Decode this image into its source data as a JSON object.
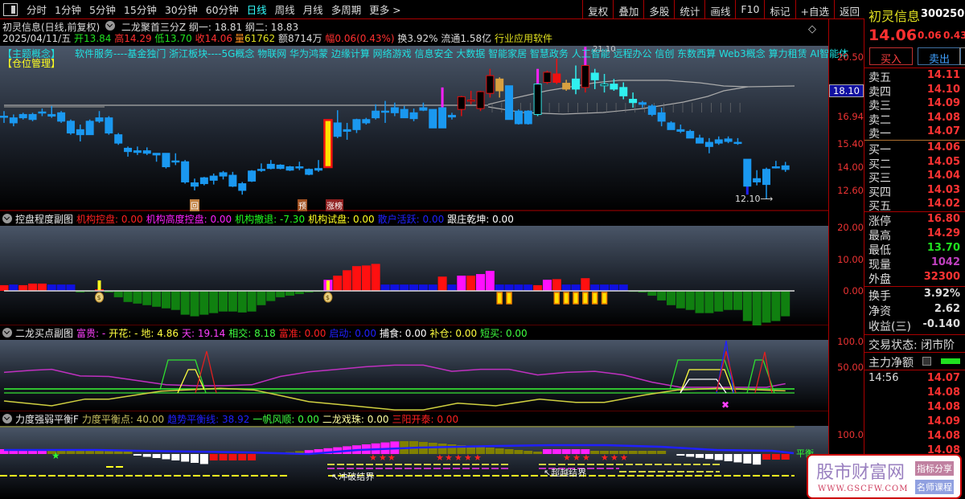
{
  "toolbar": {
    "periods": [
      "分时",
      "1分钟",
      "5分钟",
      "15分钟",
      "30分钟",
      "60分钟",
      "日线",
      "周线",
      "月线",
      "多周期",
      "更多 >"
    ],
    "active": "日线",
    "right": [
      "复权",
      "叠加",
      "多股",
      "统计",
      "画线",
      "F10",
      "标记",
      "+自选",
      "返回"
    ]
  },
  "header": {
    "title": "初灵信息(日线,前复权)",
    "indicator": "二龙聚首三分Z",
    "gang1": "纲一: 18.81",
    "gang2": "纲二: 18.83",
    "date": "2025/04/11/五",
    "open": "开13.84",
    "high": "高14.29",
    "low": "低13.70",
    "close": "收14.06",
    "vol_label": "量",
    "vol": "61762",
    "amount": "额8714万",
    "range": "幅0.06(0.43%)",
    "turnover": "换3.92%",
    "float": "流通1.58亿",
    "industry": "行业应用软件"
  },
  "theme": {
    "label": "【主题概念】",
    "text": "软件服务----基金独门 浙江板块----5G概念 物联网 华为鸿蒙 边缘计算 网络游戏 信息安全 大数据 智能家居 智慧政务 人工智能 远程办公 信创 东数西算 Web3概念 算力租赁 AI智能体",
    "position": "【仓位管理】"
  },
  "main_chart": {
    "y_axis": [
      "20.50",
      "16.94",
      "15.40",
      "14.00",
      "12.60"
    ],
    "highlight": "18.10",
    "markers": {
      "hui": "回",
      "yu": "预",
      "zhangbang": "涨榜"
    },
    "high_label": "21.10",
    "low_label": "12.10",
    "candles": [
      [
        17.0,
        17.3,
        16.6,
        16.95,
        "b"
      ],
      [
        16.9,
        17.1,
        16.4,
        16.6,
        "b"
      ],
      [
        16.9,
        17.2,
        16.8,
        17.1,
        "b"
      ],
      [
        17.1,
        17.2,
        16.7,
        16.8,
        "b"
      ],
      [
        17.2,
        17.45,
        17.0,
        17.25,
        "b"
      ],
      [
        17.1,
        17.6,
        16.9,
        17.0,
        "b"
      ],
      [
        17.2,
        17.3,
        16.6,
        16.7,
        "b"
      ],
      [
        16.7,
        16.8,
        15.9,
        16.0,
        "b"
      ],
      [
        16.2,
        16.5,
        15.5,
        15.9,
        "b"
      ],
      [
        15.9,
        16.8,
        15.9,
        16.7,
        "b"
      ],
      [
        16.9,
        17.3,
        16.6,
        16.7,
        "b"
      ],
      [
        16.9,
        17.0,
        15.9,
        16.0,
        "b"
      ],
      [
        15.9,
        16.0,
        15.3,
        15.4,
        "b"
      ],
      [
        15.1,
        15.2,
        14.6,
        14.9,
        "b"
      ],
      [
        14.95,
        15.2,
        14.7,
        14.85,
        "b"
      ],
      [
        14.95,
        15.15,
        14.7,
        14.8,
        "b"
      ],
      [
        14.8,
        14.8,
        14.3,
        14.7,
        "b"
      ],
      [
        14.8,
        14.8,
        13.9,
        14.0,
        "b"
      ],
      [
        14.35,
        14.8,
        14.1,
        14.3,
        "b"
      ],
      [
        14.3,
        14.4,
        13.0,
        13.1,
        "b"
      ],
      [
        13.05,
        13.3,
        12.6,
        12.85,
        "b"
      ],
      [
        13.0,
        13.4,
        12.9,
        13.35,
        "b"
      ],
      [
        13.2,
        13.6,
        12.95,
        13.45,
        "b"
      ],
      [
        13.45,
        13.75,
        13.25,
        13.65,
        "b"
      ],
      [
        13.5,
        13.7,
        12.8,
        12.85,
        "b"
      ],
      [
        13.0,
        13.1,
        12.35,
        12.6,
        "b"
      ],
      [
        13.15,
        13.8,
        13.1,
        13.75,
        "b"
      ],
      [
        13.8,
        14.2,
        13.7,
        13.85,
        "b"
      ],
      [
        13.9,
        14.4,
        13.85,
        14.15,
        "b"
      ],
      [
        14.1,
        14.15,
        13.85,
        13.9,
        "b"
      ],
      [
        14.0,
        14.05,
        13.75,
        13.8,
        "b"
      ],
      [
        13.95,
        14.3,
        13.8,
        14.0,
        "b"
      ],
      [
        13.85,
        13.9,
        13.5,
        13.55,
        "b"
      ],
      [
        13.8,
        14.4,
        13.7,
        13.9,
        "b"
      ],
      [
        13.98,
        16.77,
        13.95,
        16.77,
        "L"
      ],
      [
        16.6,
        17.35,
        15.7,
        15.8,
        "b"
      ],
      [
        16.1,
        16.6,
        15.6,
        16.2,
        "b"
      ],
      [
        16.2,
        16.85,
        16.0,
        16.8,
        "b"
      ],
      [
        16.6,
        16.9,
        16.5,
        16.8,
        "b"
      ],
      [
        16.9,
        17.7,
        16.8,
        17.3,
        "b"
      ],
      [
        17.3,
        17.9,
        16.6,
        17.3,
        "b"
      ],
      [
        17.2,
        17.8,
        17.0,
        17.5,
        "b"
      ],
      [
        17.4,
        17.6,
        16.9,
        16.9,
        "b"
      ],
      [
        17.2,
        17.45,
        16.7,
        16.85,
        "b"
      ],
      [
        17.5,
        17.8,
        17.3,
        17.35,
        "b"
      ],
      [
        17.4,
        17.4,
        16.3,
        16.3,
        "b"
      ],
      [
        17.5,
        18.7,
        16.3,
        16.3,
        "b",
        "m"
      ],
      [
        17.05,
        17.2,
        16.8,
        16.95,
        "b"
      ],
      [
        17.4,
        18.2,
        17.0,
        18.15,
        "r"
      ],
      [
        17.9,
        18.5,
        17.7,
        17.95,
        "r"
      ],
      [
        17.45,
        18.5,
        17.3,
        18.45,
        "r"
      ],
      [
        18.35,
        19.8,
        18.1,
        19.4,
        "r"
      ],
      [
        19.2,
        19.3,
        18.1,
        18.5,
        "o"
      ],
      [
        18.8,
        18.8,
        16.8,
        16.8,
        "b"
      ],
      [
        17.3,
        17.4,
        16.5,
        16.55,
        "b"
      ],
      [
        17.3,
        17.35,
        16.5,
        16.55,
        "b"
      ],
      [
        17.1,
        19.8,
        17.0,
        18.9,
        "k",
        "m"
      ],
      [
        19.0,
        19.7,
        18.9,
        19.6,
        "r"
      ],
      [
        19.5,
        20.4,
        18.9,
        19.0,
        "R"
      ],
      [
        18.95,
        19.15,
        18.5,
        18.6,
        "o"
      ],
      [
        18.6,
        20.0,
        18.3,
        19.2,
        "c"
      ],
      [
        18.7,
        21.1,
        18.4,
        20.0,
        "r",
        "m"
      ],
      [
        19.55,
        19.8,
        18.6,
        19.15,
        "c"
      ],
      [
        18.9,
        19.5,
        18.4,
        18.8,
        "k"
      ],
      [
        18.9,
        19.2,
        18.5,
        18.6,
        "c"
      ],
      [
        18.7,
        19.0,
        18.0,
        18.2,
        "c"
      ],
      [
        18.0,
        18.4,
        17.5,
        17.8,
        "c"
      ],
      [
        17.8,
        17.9,
        17.5,
        17.7,
        "b"
      ],
      [
        17.6,
        17.7,
        17.0,
        17.1,
        "b"
      ],
      [
        17.2,
        17.5,
        16.4,
        16.7,
        "b"
      ],
      [
        16.6,
        16.7,
        16.2,
        16.2,
        "b"
      ],
      [
        16.2,
        16.5,
        16.0,
        16.1,
        "b"
      ],
      [
        16.1,
        16.2,
        15.7,
        15.7,
        "b"
      ],
      [
        15.7,
        15.9,
        15.4,
        15.4,
        "b"
      ],
      [
        15.45,
        15.7,
        14.8,
        15.2,
        "b"
      ],
      [
        15.4,
        15.8,
        15.3,
        15.6,
        "b"
      ],
      [
        15.5,
        15.8,
        15.4,
        15.65,
        "b"
      ],
      [
        15.45,
        15.7,
        15.3,
        15.4,
        "b"
      ],
      [
        14.45,
        14.45,
        12.35,
        12.85,
        "b"
      ],
      [
        13.3,
        13.8,
        12.9,
        13.1,
        "b"
      ],
      [
        12.95,
        13.95,
        12.1,
        13.85,
        "b"
      ],
      [
        14.0,
        14.35,
        13.9,
        14.0,
        "b"
      ],
      [
        13.84,
        14.29,
        13.7,
        14.06,
        "b"
      ]
    ]
  },
  "panel_control": {
    "title": "控盘程度副图",
    "fields": [
      {
        "label": "机构控盘: 0.00",
        "color": "#ff2020"
      },
      {
        "label": "机构高度控盘: 0.00",
        "color": "#ff20ff"
      },
      {
        "label": "机构撤退: -7.30",
        "color": "#20ff20"
      },
      {
        "label": "机构试盘: 0.00",
        "color": "#ffff20"
      },
      {
        "label": "散户活跃: 0.00",
        "color": "#2020ff"
      },
      {
        "label": "跟庄乾坤: 0.00",
        "color": "#ffffff"
      }
    ],
    "y_axis": [
      "20.00",
      "10.00",
      "0.00"
    ],
    "bars": [
      [
        1.8,
        "r"
      ],
      [
        2,
        "b"
      ],
      [
        1.8,
        "r"
      ],
      [
        2.3,
        "r"
      ],
      [
        2.3,
        "r"
      ],
      [
        2,
        "b"
      ],
      [
        2,
        "b"
      ],
      [
        2,
        "b"
      ],
      [
        -0.5,
        "g"
      ],
      [
        -0.3,
        "g"
      ],
      [
        0.5,
        "r"
      ],
      [
        -0.5,
        "g"
      ],
      [
        -2,
        "g"
      ],
      [
        -3.5,
        "g"
      ],
      [
        -4,
        "g"
      ],
      [
        -4.5,
        "g"
      ],
      [
        -5,
        "g"
      ],
      [
        -5.5,
        "g"
      ],
      [
        -6,
        "g"
      ],
      [
        -7.5,
        "g"
      ],
      [
        -8,
        "g"
      ],
      [
        -7.5,
        "g"
      ],
      [
        -7,
        "g"
      ],
      [
        -6.5,
        "g"
      ],
      [
        -6.5,
        "g"
      ],
      [
        -6.8,
        "g"
      ],
      [
        -6.5,
        "g"
      ],
      [
        -4.5,
        "g"
      ],
      [
        -3.2,
        "g"
      ],
      [
        -2,
        "g"
      ],
      [
        -1.5,
        "g"
      ],
      [
        -1,
        "g"
      ],
      [
        -0.5,
        "g"
      ],
      [
        -0.3,
        "g"
      ],
      [
        3.5,
        "m"
      ],
      [
        4.8,
        "r"
      ],
      [
        6.5,
        "r"
      ],
      [
        7.8,
        "r"
      ],
      [
        8,
        "r"
      ],
      [
        8.5,
        "r"
      ],
      [
        2,
        "b"
      ],
      [
        2,
        "b"
      ],
      [
        2,
        "b"
      ],
      [
        2,
        "b"
      ],
      [
        2,
        "b"
      ],
      [
        2,
        "b"
      ],
      [
        4.5,
        "r"
      ],
      [
        2,
        "b"
      ],
      [
        4.8,
        "m"
      ],
      [
        4.8,
        "r"
      ],
      [
        5.3,
        "m"
      ],
      [
        6.3,
        "m"
      ],
      [
        2,
        "b"
      ],
      [
        2,
        "b"
      ],
      [
        2,
        "b"
      ],
      [
        2,
        "b"
      ],
      [
        1.8,
        "r"
      ],
      [
        3.5,
        "m"
      ],
      [
        3.7,
        "r"
      ],
      [
        2,
        "b"
      ],
      [
        2,
        "b"
      ],
      [
        4,
        "r"
      ],
      [
        2,
        "b"
      ],
      [
        2,
        "b"
      ],
      [
        2,
        "b"
      ],
      [
        2,
        "b"
      ],
      [
        -0.3,
        "g"
      ],
      [
        -0.5,
        "g"
      ],
      [
        -1.5,
        "g"
      ],
      [
        -3,
        "g"
      ],
      [
        -4.5,
        "g"
      ],
      [
        -5.5,
        "g"
      ],
      [
        -6,
        "g"
      ],
      [
        -7,
        "g"
      ],
      [
        -7,
        "g"
      ],
      [
        -6.5,
        "g"
      ],
      [
        -6,
        "g"
      ],
      [
        -6,
        "g"
      ],
      [
        -9.5,
        "g"
      ],
      [
        -11,
        "g"
      ],
      [
        -10,
        "g"
      ],
      [
        -9.5,
        "g"
      ],
      [
        -8,
        "g"
      ]
    ],
    "orange_marks": [
      52,
      53,
      58,
      59,
      60,
      61,
      62,
      63
    ],
    "bag_marks": [
      10,
      34
    ]
  },
  "panel_dragon": {
    "title": "二龙买点副图",
    "fields": [
      {
        "label": "富贵: -",
        "color": "#ff40ff"
      },
      {
        "label": "开花: -",
        "color": "#ffff40"
      },
      {
        "label": "地: 4.86",
        "color": "#ffff40"
      },
      {
        "label": "天: 19.14",
        "color": "#ff40ff"
      },
      {
        "label": "相交: 8.18",
        "color": "#40ff40"
      },
      {
        "label": "富准: 0.00",
        "color": "#ff2020"
      },
      {
        "label": "启动: 0.00",
        "color": "#2020ff"
      },
      {
        "label": "捕食: 0.00",
        "color": "#ffffff"
      },
      {
        "label": "补仓: 0.00",
        "color": "#ffff40"
      },
      {
        "label": "短买: 0.00",
        "color": "#40ff40"
      }
    ],
    "y_axis": [
      "100.0",
      "50.00"
    ],
    "magenta_line": [
      [
        0,
        40
      ],
      [
        3,
        44
      ],
      [
        5,
        46
      ],
      [
        8,
        33
      ],
      [
        11,
        32
      ],
      [
        14,
        24
      ],
      [
        17,
        16
      ],
      [
        20,
        14
      ],
      [
        23,
        14
      ],
      [
        26,
        16
      ],
      [
        29,
        32
      ],
      [
        32,
        41
      ],
      [
        35,
        46
      ],
      [
        38,
        51
      ],
      [
        41,
        54
      ],
      [
        44,
        54
      ],
      [
        47,
        42
      ],
      [
        50,
        46
      ],
      [
        53,
        46
      ],
      [
        56,
        35
      ],
      [
        59,
        40
      ],
      [
        62,
        42
      ],
      [
        65,
        35
      ],
      [
        68,
        21
      ],
      [
        71,
        11
      ],
      [
        74,
        11
      ],
      [
        77,
        11
      ],
      [
        80,
        11
      ],
      [
        82,
        18
      ]
    ],
    "yellow_line": [
      [
        0,
        -15.6
      ],
      [
        5,
        -25
      ],
      [
        8.5,
        -12
      ],
      [
        11,
        -12
      ],
      [
        16.5,
        3.6
      ],
      [
        22.7,
        9
      ],
      [
        26.2,
        6
      ],
      [
        32,
        -17
      ],
      [
        36.6,
        -25
      ],
      [
        41,
        -33
      ],
      [
        44,
        -33
      ],
      [
        47.6,
        -20
      ],
      [
        51.6,
        -25
      ],
      [
        56.2,
        -12
      ],
      [
        60,
        -18.5
      ],
      [
        63,
        -18.5
      ],
      [
        67.2,
        -4
      ],
      [
        70.7,
        6
      ],
      [
        75,
        9
      ],
      [
        82,
        4
      ]
    ]
  },
  "panel_force": {
    "title": "力度强弱平衡F",
    "fields": [
      {
        "label": "力度平衡点: 40.00",
        "color": "#c8c060"
      },
      {
        "label": "趋势平衡线: 38.92",
        "color": "#2020ff"
      },
      {
        "label": "一帆风顺: 0.00",
        "color": "#40ff40"
      },
      {
        "label": "二龙戏珠: 0.00",
        "color": "#ffffa0"
      },
      {
        "label": "三阳开泰: 0.00",
        "color": "#ff2020"
      }
    ],
    "y_axis": [
      "100.0"
    ],
    "label_break": "冲破结界",
    "label_exceed": "超越结界",
    "label_balance": "平衡"
  },
  "quote": {
    "name": "初灵信息",
    "code": "300250",
    "price": "14.06",
    "change": "0.06",
    "pct": "0.43%",
    "buy": "买入",
    "sell": "卖出",
    "asks": [
      {
        "l": "卖五",
        "v": "14.11"
      },
      {
        "l": "卖四",
        "v": "14.10"
      },
      {
        "l": "卖三",
        "v": "14.09"
      },
      {
        "l": "卖二",
        "v": "14.08"
      },
      {
        "l": "卖一",
        "v": "14.07"
      }
    ],
    "bids": [
      {
        "l": "买一",
        "v": "14.06"
      },
      {
        "l": "买二",
        "v": "14.05"
      },
      {
        "l": "买三",
        "v": "14.04"
      },
      {
        "l": "买四",
        "v": "14.03"
      },
      {
        "l": "买五",
        "v": "14.02"
      }
    ],
    "stats": [
      {
        "l": "涨停",
        "v": "16.80",
        "c": "#ff3333"
      },
      {
        "l": "最高",
        "v": "14.29",
        "c": "#ff3333"
      },
      {
        "l": "最低",
        "v": "13.70",
        "c": "#20e020"
      },
      {
        "l": "现量",
        "v": "1042",
        "c": "#c040c0"
      },
      {
        "l": "外盘",
        "v": "32300",
        "c": "#ff3333"
      }
    ],
    "stats2": [
      {
        "l": "换手",
        "v": "3.92%"
      },
      {
        "l": "净资",
        "v": "2.62"
      },
      {
        "l": "收益(三)",
        "v": "-0.140"
      }
    ],
    "status": "交易状态: 闭市阶",
    "net": "主力净额",
    "tick_time": "14:56",
    "ticks": [
      "14.07",
      "14.08",
      "14.08",
      "14.09",
      "14.08",
      "14.08"
    ]
  },
  "watermark": {
    "cn": "股市财富网",
    "url": "WWW.GSCFW.COM",
    "tag1": "指标分享",
    "tag2": "名师课程"
  }
}
